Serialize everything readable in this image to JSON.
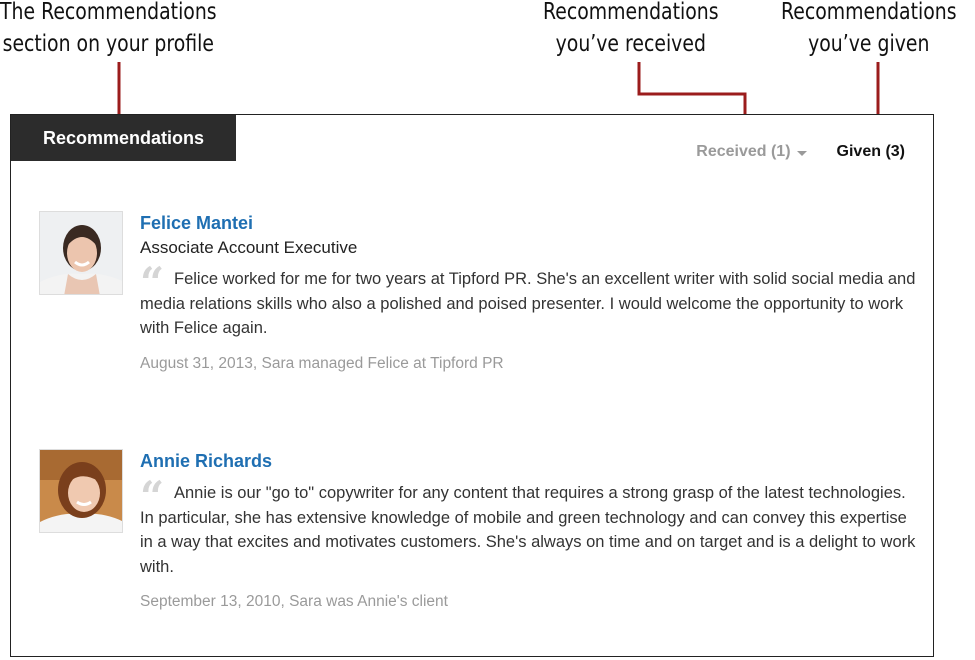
{
  "callouts": {
    "profile": {
      "line1": "The Recommendations",
      "line2": "section on your profile"
    },
    "received": {
      "line1": "Recommendations",
      "line2": "you’ve received"
    },
    "given": {
      "line1": "Recommendations",
      "line2": "you’ve given"
    }
  },
  "section": {
    "title": "Recommendations",
    "tabs": {
      "received": "Received (1)",
      "given": "Given (3)"
    }
  },
  "recommendations": [
    {
      "name": "Felice Mantei",
      "title": "Associate Account Executive",
      "quote_mark": "“",
      "text": "Felice worked for me for two years at Tipford PR. She's an excellent writer with solid social media and media relations skills who also a polished and poised presenter. I would welcome the opportunity to work with Felice again.",
      "date": "August 31, 2013, Sara managed Felice at Tipford PR"
    },
    {
      "name": "Annie Richards",
      "title": "",
      "quote_mark": "“",
      "text": "Annie is our \"go to\" copywriter for any content that requires a strong grasp of the latest technologies. In particular, she has extensive knowledge of mobile and green technology and can convey this expertise in a way that excites and motivates customers. She's always on time and on target and is a delight to work with.",
      "date": "September 13, 2010, Sara was Annie's client"
    }
  ],
  "colors": {
    "link": "#1f6fb2",
    "leader_line": "#9b1c1c",
    "tab_background": "#2c2c2c"
  }
}
